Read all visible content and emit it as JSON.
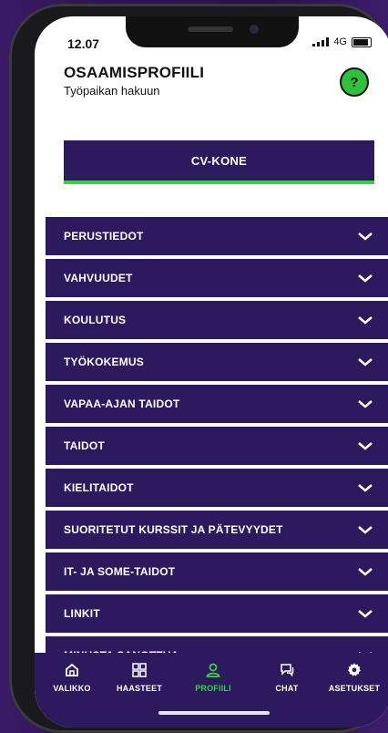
{
  "status_bar": {
    "time": "12.07",
    "network": "4G"
  },
  "header": {
    "title": "OSAAMISPROFIILI",
    "subtitle": "Työpaikan hakuun",
    "help_label": "?"
  },
  "cv_button": {
    "label": "CV-KONE"
  },
  "sections": [
    {
      "label": "PERUSTIEDOT"
    },
    {
      "label": "VAHVUUDET"
    },
    {
      "label": "KOULUTUS"
    },
    {
      "label": "TYÖKOKEMUS"
    },
    {
      "label": "VAPAA-AJAN TAIDOT"
    },
    {
      "label": "TAIDOT"
    },
    {
      "label": "KIELITAIDOT"
    },
    {
      "label": "SUORITETUT KURSSIT JA PÄTEVYYDET"
    },
    {
      "label": "IT- JA SOME-TAIDOT"
    },
    {
      "label": "LINKIT"
    },
    {
      "label": "MINUSTA SANOTTUA"
    }
  ],
  "bottom_nav": [
    {
      "label": "VALIKKO",
      "icon": "home-icon",
      "active": false
    },
    {
      "label": "HAASTEET",
      "icon": "grid-icon",
      "active": false
    },
    {
      "label": "PROFIILI",
      "icon": "person-icon",
      "active": true
    },
    {
      "label": "CHAT",
      "icon": "chat-icon",
      "active": false
    },
    {
      "label": "ASETUKSET",
      "icon": "gear-icon",
      "active": false
    }
  ],
  "colors": {
    "primary": "#2d1a5e",
    "accent": "#38d048",
    "background": "#ffffff"
  }
}
